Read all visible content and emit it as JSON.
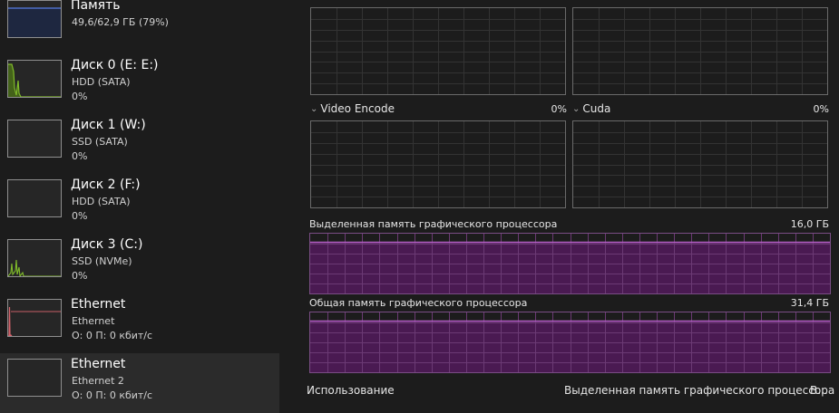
{
  "sidebar": {
    "items": [
      {
        "title": "Память",
        "sub": "49,6/62,9 ГБ (79%)",
        "value": ""
      },
      {
        "title": "Диск 0 (E: E:)",
        "sub": "HDD (SATA)",
        "value": "0%"
      },
      {
        "title": "Диск 1 (W:)",
        "sub": "SSD (SATA)",
        "value": "0%"
      },
      {
        "title": "Диск 2 (F:)",
        "sub": "HDD (SATA)",
        "value": "0%"
      },
      {
        "title": "Диск 3 (C:)",
        "sub": "SSD (NVMe)",
        "value": "0%"
      },
      {
        "title": "Ethernet",
        "sub": "Ethernet",
        "value": "О: 0 П: 0 кбит/с"
      },
      {
        "title": "Ethernet",
        "sub": "Ethernet 2",
        "value": "О: 0 П: 0 кбит/с"
      }
    ],
    "selected_index": 6
  },
  "engines": {
    "video_encode": {
      "label": "Video Encode",
      "value": "0%"
    },
    "cuda": {
      "label": "Cuda",
      "value": "0%"
    }
  },
  "dedicated_memory": {
    "label": "Выделенная память графического процессора",
    "total": "16,0 ГБ"
  },
  "shared_memory": {
    "label": "Общая память графического процессора",
    "total": "31,4 ГБ"
  },
  "footer": {
    "usage_label": "Использование",
    "dedicated_label": "Выделенная память графического процессора",
    "more_label": "В..."
  },
  "colors": {
    "memory_accent": "#4f6fc5",
    "disk_accent": "#7fba2a",
    "network_accent": "#d9646c",
    "gpu_memory_accent": "#b35fc4",
    "gpu_memory_fill": "#4a1a52"
  }
}
